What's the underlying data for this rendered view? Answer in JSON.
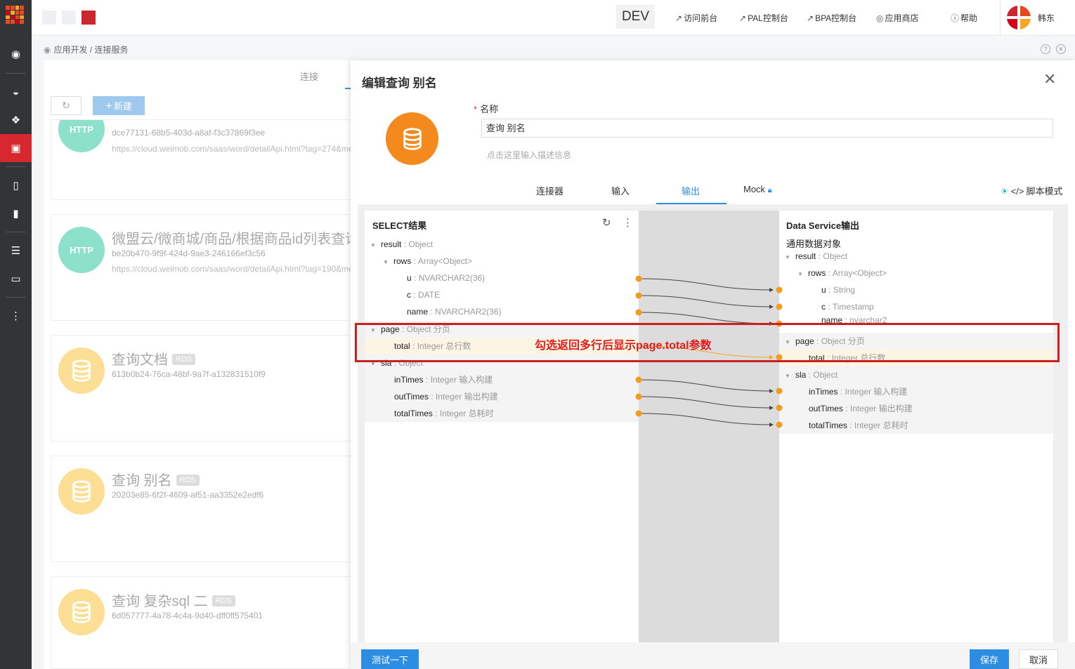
{
  "topbar": {
    "env": "DEV",
    "links": [
      "访问前台",
      "PAL控制台",
      "BPA控制台",
      "应用商店",
      "帮助"
    ],
    "user": "韩东"
  },
  "breadcrumb": "应用开发 / 连接服务",
  "background": {
    "tab": "连接",
    "new_button": "新建",
    "cards": [
      {
        "icon": "HTTP",
        "title": "",
        "id": "dce77131-68b5-403d-a8af-f3c37869f3ee",
        "url": "https://cloud.weimob.com/saas/word/detailApi.html?tag=274&me",
        "badge": ""
      },
      {
        "icon": "HTTP",
        "title": "微盟云/微商城/商品/根据商品id列表查询",
        "id": "be20b470-9f9f-424d-9ae3-246166ef3c56",
        "url": "https://cloud.weimob.com/saas/word/detailApi.html?tag=190&me",
        "badge": ""
      },
      {
        "icon": "db",
        "title": "查询文档",
        "badge": "RDS",
        "id": "613b0b24-76ca-48bf-9a7f-a132831510f9",
        "url": ""
      },
      {
        "icon": "db",
        "title": "查询 别名",
        "badge": "RDS",
        "id": "20203e85-6f2f-4609-af51-aa3352e2edf6",
        "url": ""
      },
      {
        "icon": "db",
        "title": "查询 复杂sql 二",
        "badge": "RDS",
        "id": "6d057777-4a78-4c4a-9d40-dff0ff575401",
        "url": ""
      }
    ]
  },
  "drawer": {
    "title": "编辑查询 别名",
    "name_label": "名称",
    "name_value": "查询 别名",
    "desc_placeholder": "点击这里输入描述信息",
    "tabs": [
      "连接器",
      "输入",
      "输出",
      "Mock"
    ],
    "active_tab": "输出",
    "script_mode": "脚本模式",
    "left_title": "SELECT结果",
    "right_title": "Data Service输出",
    "right_subtitle": "通用数据对象",
    "left_tree": [
      {
        "name": "result",
        "type": "Object"
      },
      {
        "name": "rows",
        "type": "Array<Object>"
      },
      {
        "name": "u",
        "type": "NVARCHAR2(36)"
      },
      {
        "name": "c",
        "type": "DATE"
      },
      {
        "name": "name",
        "type": "NVARCHAR2(36)"
      },
      {
        "name": "page",
        "type": "Object 分页"
      },
      {
        "name": "total",
        "type": "Integer 总行数"
      },
      {
        "name": "sla",
        "type": "Object"
      },
      {
        "name": "inTimes",
        "type": "Integer 输入构建"
      },
      {
        "name": "outTimes",
        "type": "Integer 输出构建"
      },
      {
        "name": "totalTimes",
        "type": "Integer 总耗时"
      }
    ],
    "right_tree": [
      {
        "name": "result",
        "type": "Object"
      },
      {
        "name": "rows",
        "type": "Array<Object>"
      },
      {
        "name": "u",
        "type": "String"
      },
      {
        "name": "c",
        "type": "Timestamp"
      },
      {
        "name": "name",
        "type": "nvarchar2"
      },
      {
        "name": "page",
        "type": "Object 分页"
      },
      {
        "name": "total",
        "type": "Integer 总行数"
      },
      {
        "name": "sla",
        "type": "Object"
      },
      {
        "name": "inTimes",
        "type": "Integer 输入构建"
      },
      {
        "name": "outTimes",
        "type": "Integer 输出构建"
      },
      {
        "name": "totalTimes",
        "type": "Integer 总耗时"
      }
    ],
    "annotation": "勾选返回多行后显示page.total参数",
    "test_button": "测试一下",
    "save_button": "保存",
    "cancel_button": "取消"
  },
  "colors": {
    "accent": "#2d8de3",
    "connector": "#f39c1f",
    "annotation": "#cc1f1f",
    "nav_active": "#d7282f"
  }
}
